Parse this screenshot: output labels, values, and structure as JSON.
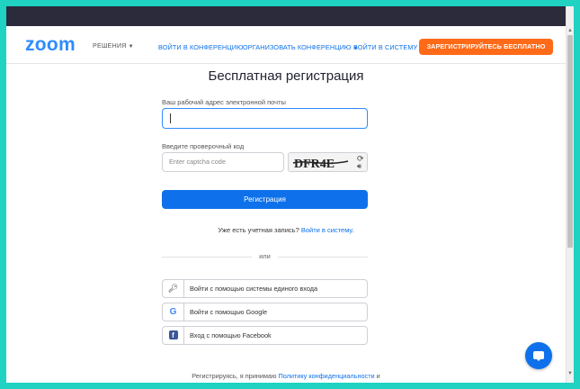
{
  "header": {
    "logo": "zoom",
    "solutions": "РЕШЕНИЯ",
    "join": "ВОЙТИ В КОНФЕРЕНЦИЮ",
    "host": "ОРГАНИЗОВАТЬ КОНФЕРЕНЦИЮ",
    "signin": "ВОЙТИ В СИСТЕМУ",
    "signup": "ЗАРЕГИСТРИРУЙТЕСЬ БЕСПЛАТНО"
  },
  "form": {
    "title": "Бесплатная регистрация",
    "email_label": "Ваш рабочий адрес электронной почты",
    "email_value": "",
    "captcha_label": "Введите проверочный код",
    "captcha_placeholder": "Enter captcha code",
    "captcha_text": "DFR4E",
    "register": "Регистрация",
    "have_account": "Уже есть учетная запись?",
    "signin_link": "Войти в систему",
    "signin_period": ".",
    "or": "или",
    "sso": "Войти с помощью системы единого входа",
    "google": "Войти с помощью Google",
    "facebook": "Вход с помощью Facebook",
    "terms_prefix": "Регистрируясь, я принимаю",
    "terms_link": "Политику конфиденциальности",
    "terms_suffix": "и"
  },
  "icons": {
    "caret": "chevron-down",
    "sso": "key",
    "google": "google",
    "facebook": "facebook",
    "chat": "chat-bubble"
  },
  "colors": {
    "accent": "#0e71eb",
    "signup": "#ff6a18",
    "background": "#1fd2c2"
  }
}
